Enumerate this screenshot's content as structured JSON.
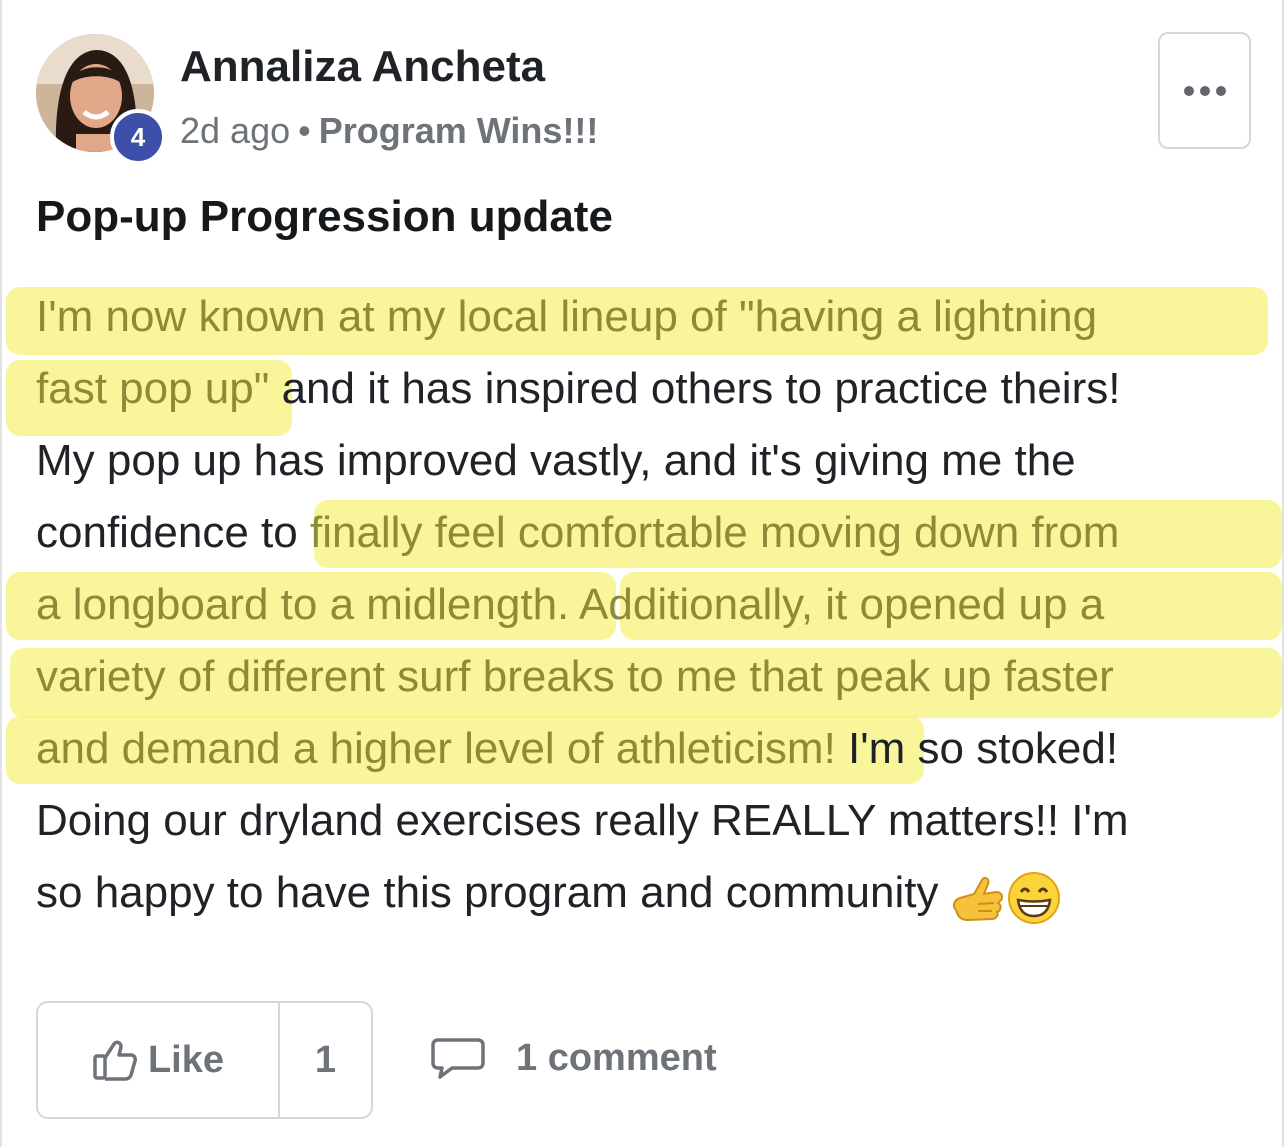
{
  "post": {
    "author": {
      "name": "Annaliza Ancheta",
      "level": "4",
      "avatar_icon": "user-avatar-photo"
    },
    "meta": {
      "time_ago": "2d ago",
      "separator": "•",
      "category": "Program Wins!!!"
    },
    "more_icon": "more-horizontal-icon",
    "title": "Pop-up Progression update",
    "body_lines": [
      [
        {
          "text": "I'm now known at my local lineup of \"having a lightning",
          "hl": true
        }
      ],
      [
        {
          "text": "fast pop up\"",
          "hl": true
        },
        {
          "text": " and it has inspired others to practice theirs!",
          "hl": false
        }
      ],
      [
        {
          "text": "My pop up has improved vastly, and it's giving me the",
          "hl": false
        }
      ],
      [
        {
          "text": "confidence to ",
          "hl": false
        },
        {
          "text": "finally feel comfortable moving down from",
          "hl": true
        }
      ],
      [
        {
          "text": "a longboard to a midlength. Additionally, it opened up a",
          "hl": true
        }
      ],
      [
        {
          "text": "variety of different surf breaks to me that peak up faster",
          "hl": true
        }
      ],
      [
        {
          "text": "and demand a higher level of athleticism!",
          "hl": true
        },
        {
          "text": " I'm so stoked!",
          "hl": false
        }
      ],
      [
        {
          "text": "Doing our dryland exercises really REALLY matters!! I'm",
          "hl": false
        }
      ],
      [
        {
          "text": "so happy to have this program and community",
          "hl": false
        }
      ]
    ],
    "emojis": [
      "call-me-hand-emoji",
      "grinning-face-emoji"
    ],
    "highlight_color": "#f5f27a"
  },
  "footer": {
    "like_label": "Like",
    "like_count": "1",
    "like_icon": "thumbs-up-icon",
    "comment_icon": "comment-bubble-icon",
    "comment_label": "1 comment"
  }
}
